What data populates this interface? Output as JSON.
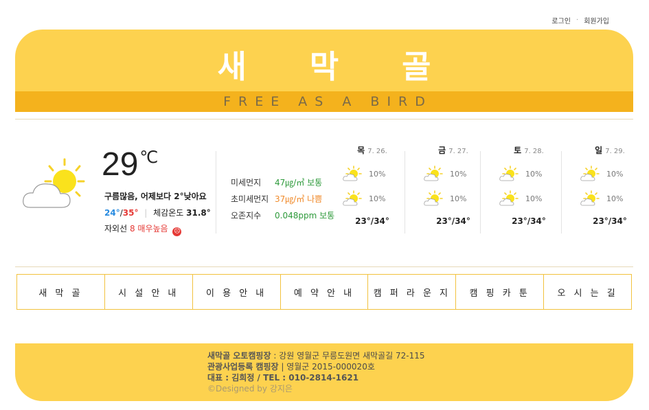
{
  "top_links": {
    "login": "로그인",
    "dot": "·",
    "signup": "회원가입"
  },
  "header": {
    "brand": "새 막 골",
    "tagline": "FREE AS A BIRD"
  },
  "colors": {
    "header_yellow": "#fdd24f",
    "tagline_bar": "#f4b21d",
    "nav_border": "#f2c23e",
    "low_temp": "#2a8ce0",
    "high_temp": "#e53935",
    "good": "#2e9a3b",
    "bad": "#f08a2a"
  },
  "current": {
    "icon": "partly-cloudy-icon",
    "temp": "29",
    "unit": "℃",
    "condition": "구름많음, 어제보다 2°낮아요",
    "low": "24°",
    "slash": "/",
    "high": "35°",
    "feels_label": "체감온도",
    "feels_value": "31.8°",
    "uv_label": "자외선",
    "uv_value": "8 매우높음",
    "uv_icon": "sad-face-icon"
  },
  "air": [
    {
      "label": "미세먼지",
      "value": "47㎍/㎥ 보통",
      "status": "good"
    },
    {
      "label": "초미세먼지",
      "value": "37㎍/㎥ 나쁨",
      "status": "bad"
    },
    {
      "label": "오존지수",
      "value": "0.048ppm 보통",
      "status": "good"
    }
  ],
  "forecast": [
    {
      "day": "목",
      "date": "7. 26.",
      "am": "10%",
      "pm": "10%",
      "range": "23°/34°",
      "icon": "partly-sunny-icon"
    },
    {
      "day": "금",
      "date": "7. 27.",
      "am": "10%",
      "pm": "10%",
      "range": "23°/34°",
      "icon": "partly-sunny-icon"
    },
    {
      "day": "토",
      "date": "7. 28.",
      "am": "10%",
      "pm": "10%",
      "range": "23°/34°",
      "icon": "partly-sunny-icon"
    },
    {
      "day": "일",
      "date": "7. 29.",
      "am": "10%",
      "pm": "10%",
      "range": "23°/34°",
      "icon": "partly-sunny-icon"
    }
  ],
  "nav": [
    "새 막 골",
    "시 설 안 내",
    "이 용 안 내",
    "예 약 안 내",
    "캠 퍼 라 운 지",
    "캠 핑 카 툰",
    "오 시 는 길"
  ],
  "footer": {
    "name": "새막골 오토캠핑장",
    "address": " : 강원 영월군 무릉도원면 새막골길 72-115",
    "reg_label": "관광사업등록 캠핑장",
    "reg_value": " | 영월군 2015-000020호",
    "rep": "대표 : 김희정 / TEL : 010-2814-1621",
    "credit": "©Designed by 강지은"
  }
}
